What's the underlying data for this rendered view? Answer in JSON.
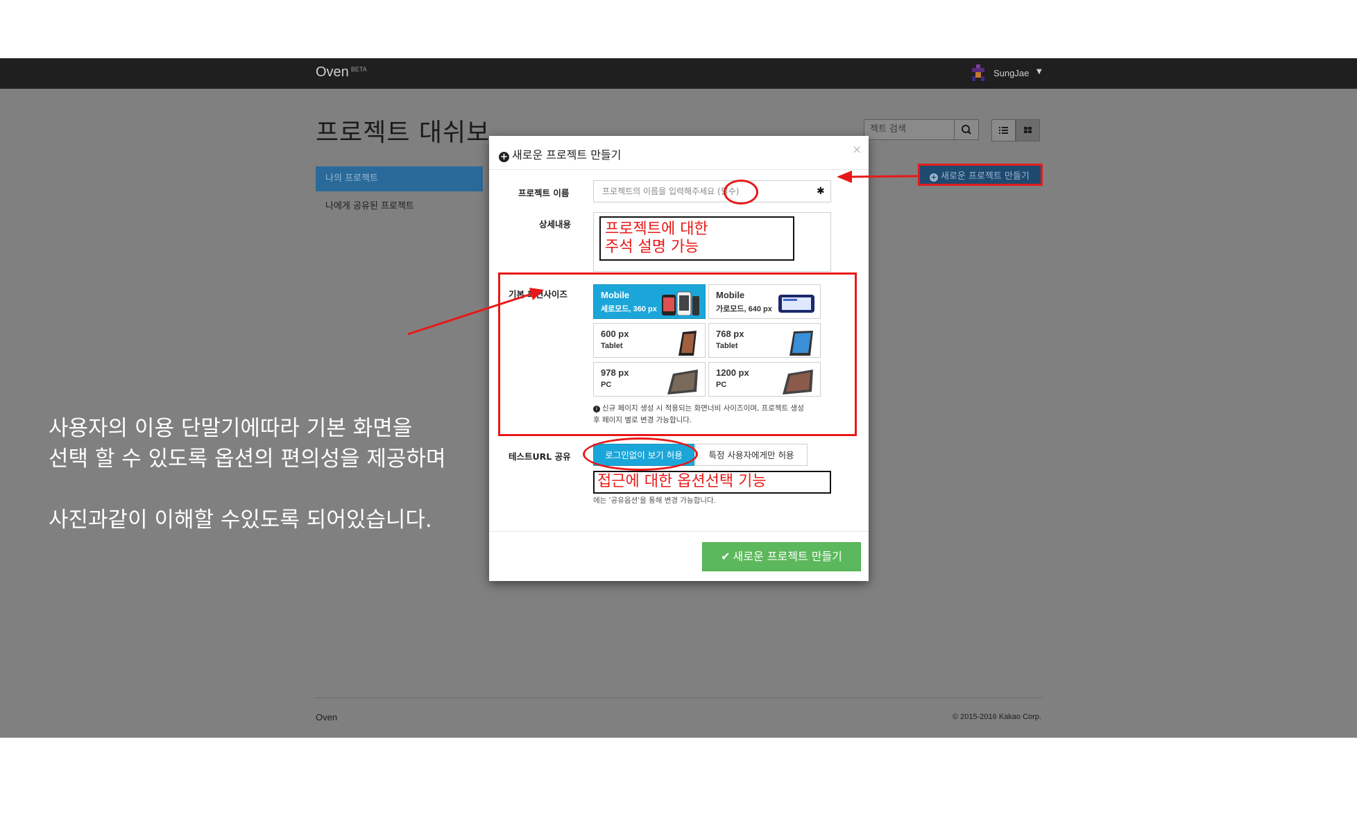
{
  "navbar": {
    "brand": "Oven",
    "brand_badge": "BETA",
    "user_name": "SungJae"
  },
  "dashboard": {
    "title": "프로젝트 대쉬보",
    "sidebar": [
      {
        "label": "나의 프로젝트",
        "active": true
      },
      {
        "label": "나에게 공유된 프로젝트",
        "active": false
      }
    ],
    "search_placeholder": "젝트 검색",
    "new_project_button": "새로운 프로젝트 만들기"
  },
  "footer": {
    "brand": "Oven",
    "copyright": "© 2015-2016 Kakao Corp."
  },
  "annotation": {
    "line1": "사용자의 이용 단말기에따라  기본 화면을",
    "line2": "선택 할 수 있도록 옵션의 편의성을 제공하며",
    "line3": "사진과같이 이해할 수있도록 되어있습니다.",
    "desc_callout": [
      "프로젝트에 대한",
      "주석 설명 가능"
    ],
    "share_callout": "접근에 대한 옵션선택 기능"
  },
  "modal": {
    "title": "새로운 프로젝트 만들기",
    "close": "×",
    "name_label": "프로젝트 이름",
    "name_placeholder": "프로젝트의 이름을 입력해주세요 (필수)",
    "name_required_mark": "✱",
    "desc_label": "상세내용",
    "size_label": "기본 화면사이즈",
    "sizes": [
      {
        "title": "Mobile",
        "sub": "세로모드, 360 px",
        "selected": true,
        "device": "phone-portrait-icon"
      },
      {
        "title": "Mobile",
        "sub": "가로모드, 640 px",
        "selected": false,
        "device": "phone-landscape-icon"
      },
      {
        "title": "600 px",
        "sub": "Tablet",
        "selected": false,
        "device": "tablet-small-icon"
      },
      {
        "title": "768 px",
        "sub": "Tablet",
        "selected": false,
        "device": "tablet-icon"
      },
      {
        "title": "978 px",
        "sub": "PC",
        "selected": false,
        "device": "pc-small-icon"
      },
      {
        "title": "1200 px",
        "sub": "PC",
        "selected": false,
        "device": "pc-icon"
      }
    ],
    "size_note_1": "신규 페이지 생성 시 적용되는 화면너비 사이즈이며, 프로젝트 생성",
    "size_note_2": "후 페이지 별로 변경 가능합니다.",
    "share_label": "테스트URL 공유",
    "share_options": [
      {
        "label": "로그인없이 보기 허용",
        "selected": true
      },
      {
        "label": "특정 사용자에게만 허용",
        "selected": false
      }
    ],
    "share_note": "에는 '공유옵션'을 통해 변경 가능합니다.",
    "create_button": "새로운 프로젝트 만들기"
  },
  "colors": {
    "accent_blue": "#1ba6d9",
    "success_green": "#5cb85c",
    "annotation_red": "#e81818",
    "navbar": "#1f1f1f",
    "overlay": "#808080"
  }
}
